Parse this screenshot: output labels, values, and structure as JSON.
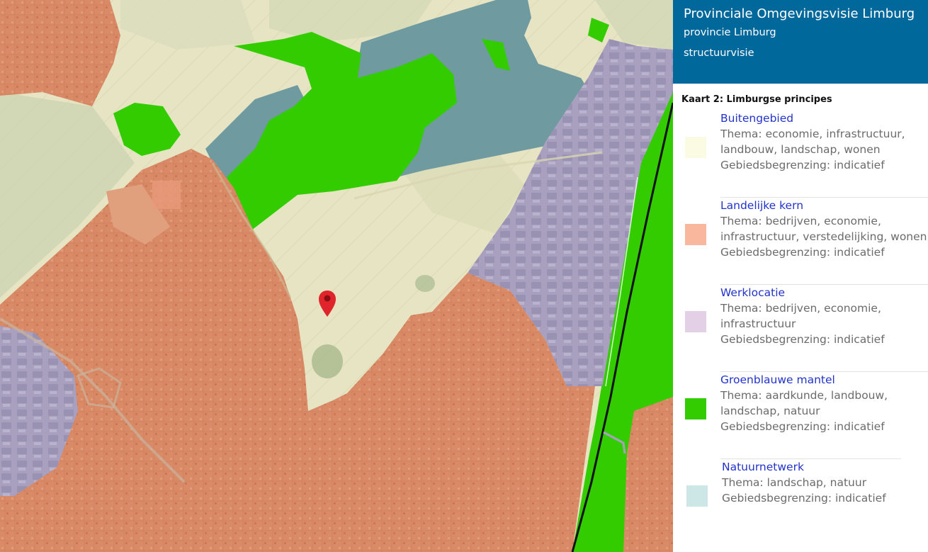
{
  "panel": {
    "title": "Provinciale Omgevingsvisie Limburg",
    "subtitle": "provincie Limburg",
    "type": "structuurvisie",
    "map_title": "Kaart 2: Limburgse principes"
  },
  "legend": [
    {
      "name": "Buitengebied",
      "theme": "Thema: economie, infrastructuur, landbouw, landschap, wonen",
      "boundary": "Gebiedsbegrenzing: indicatief",
      "color": "#fbfbe3",
      "icon": "swatch-buitengebied"
    },
    {
      "name": "Landelijke kern",
      "theme": "Thema: bedrijven, economie, infrastructuur, verstedelijking, wonen",
      "boundary": "Gebiedsbegrenzing: indicatief",
      "color": "#f9b79d",
      "icon": "swatch-landelijke-kern"
    },
    {
      "name": "Werklocatie",
      "theme": "Thema: bedrijven, economie, infrastructuur",
      "boundary": "Gebiedsbegrenzing: indicatief",
      "color": "#e3cfe6",
      "icon": "swatch-werklocatie"
    },
    {
      "name": "Groenblauwe mantel",
      "theme": "Thema: aardkunde, landbouw, landschap, natuur",
      "boundary": "Gebiedsbegrenzing: indicatief",
      "color": "#33cc00",
      "icon": "swatch-groenblauwe-mantel"
    },
    {
      "name": "Natuurnetwerk",
      "theme": "Thema: landschap, natuur",
      "boundary": "Gebiedsbegrenzing: indicatief",
      "color": "#cde6e6",
      "icon": "swatch-natuurnetwerk"
    }
  ],
  "map": {
    "colors": {
      "buitengebied": "#e6e4c3",
      "kern": "#d98a66",
      "werklocatie": "#a9a0c0",
      "groen": "#33cc00",
      "natuur": "#6e9aa0",
      "marker": "#e0242b"
    },
    "marker_icon": "location-pin-icon"
  }
}
